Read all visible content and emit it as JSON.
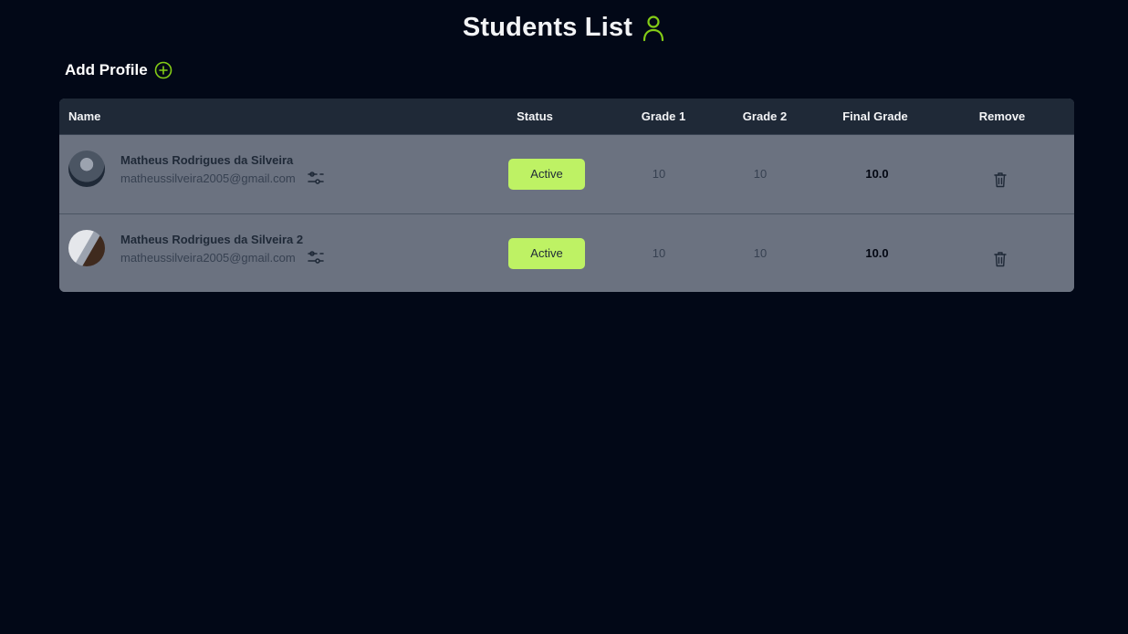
{
  "header": {
    "title": "Students List",
    "icon": "user-icon",
    "accent": "#84cc16"
  },
  "add_profile": {
    "label": "Add Profile",
    "icon": "plus-circle-icon"
  },
  "table": {
    "columns": [
      "Name",
      "Status",
      "Grade 1",
      "Grade 2",
      "Final Grade",
      "Remove"
    ],
    "rows": [
      {
        "name": "Matheus Rodrigues da Silveira",
        "email": "matheussilveira2005@gmail.com",
        "status": "Active",
        "grade1": "10",
        "grade2": "10",
        "final_grade": "10.0"
      },
      {
        "name": "Matheus Rodrigues da Silveira 2",
        "email": "matheussilveira2005@gmail.com",
        "status": "Active",
        "grade1": "10",
        "grade2": "10",
        "final_grade": "10.0"
      }
    ]
  },
  "colors": {
    "background": "#020817",
    "header_row": "#1f2937",
    "body_row": "#6b7280",
    "status_active": "#bef264"
  }
}
